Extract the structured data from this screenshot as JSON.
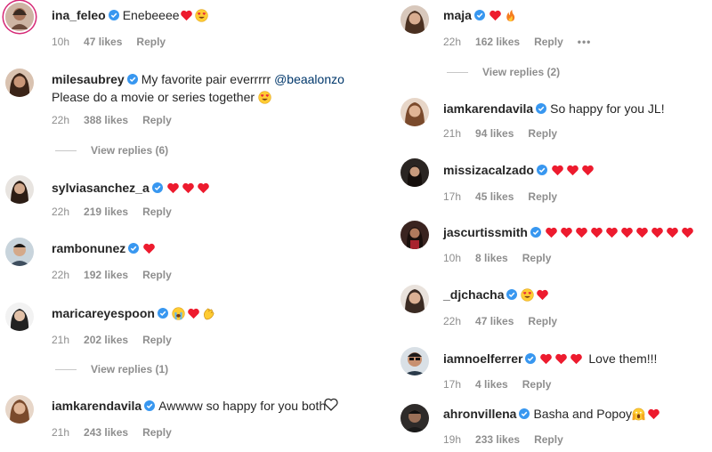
{
  "colors": {
    "verified": "#3897f0",
    "heart": "#ed1b2e",
    "mention": "#00376b",
    "meta": "#8e8e8e"
  },
  "left": [
    {
      "username": "ina_feleo",
      "text": "Enebeeee",
      "emojis": [
        "red-heart",
        "heart-eyes-face"
      ],
      "time": "10h",
      "likes": "47 likes",
      "reply": "Reply",
      "story_ring": true
    },
    {
      "username": "milesaubrey",
      "text": "My favorite pair everrrrr",
      "mention": "@beaalonzo",
      "text2": "Please do a movie or series together",
      "emojis": [
        "heart-eyes-face"
      ],
      "time": "22h",
      "likes": "388 likes",
      "reply": "Reply",
      "view_replies": "View replies (6)"
    },
    {
      "username": "sylviasanchez_a",
      "text": "",
      "emojis": [
        "red-heart",
        "red-heart",
        "red-heart"
      ],
      "time": "22h",
      "likes": "219 likes",
      "reply": "Reply"
    },
    {
      "username": "rambonunez",
      "text": "",
      "emojis": [
        "red-heart"
      ],
      "time": "22h",
      "likes": "192 likes",
      "reply": "Reply"
    },
    {
      "username": "maricareyespoon",
      "text": "",
      "emojis": [
        "crying-face",
        "red-heart",
        "clapping-hands"
      ],
      "time": "21h",
      "likes": "202 likes",
      "reply": "Reply",
      "view_replies": "View replies (1)"
    },
    {
      "username": "iamkarendavila",
      "text": "Awwww so happy for you both",
      "emojis": [],
      "time": "21h",
      "likes": "243 likes",
      "reply": "Reply",
      "like_icon": "heart-outline-icon"
    }
  ],
  "right": [
    {
      "username": "maja",
      "text": "",
      "emojis": [
        "red-heart",
        "fire"
      ],
      "time": "22h",
      "likes": "162 likes",
      "reply": "Reply",
      "more": "•••",
      "view_replies": "View replies (2)"
    },
    {
      "username": "iamkarendavila",
      "text": "So happy for you JL!",
      "emojis": [],
      "time": "21h",
      "likes": "94 likes",
      "reply": "Reply"
    },
    {
      "username": "missizacalzado",
      "text": "",
      "emojis": [
        "red-heart",
        "red-heart",
        "red-heart"
      ],
      "time": "17h",
      "likes": "45 likes",
      "reply": "Reply"
    },
    {
      "username": "jascurtissmith",
      "text": "",
      "emojis": [
        "red-heart",
        "red-heart",
        "red-heart",
        "red-heart",
        "red-heart",
        "red-heart",
        "red-heart",
        "red-heart",
        "red-heart",
        "red-heart"
      ],
      "time": "10h",
      "likes": "8 likes",
      "reply": "Reply"
    },
    {
      "username": "_djchacha",
      "text": "",
      "emojis": [
        "heart-eyes-face",
        "red-heart"
      ],
      "time": "22h",
      "likes": "47 likes",
      "reply": "Reply"
    },
    {
      "username": "iamnoelferrer",
      "text": "Love them!!!",
      "emojis_before": [
        "red-heart",
        "red-heart",
        "red-heart"
      ],
      "emojis": [],
      "time": "17h",
      "likes": "4 likes",
      "reply": "Reply"
    },
    {
      "username": "ahronvillena",
      "text": "Basha and Popoy",
      "emojis": [
        "screaming-face",
        "red-heart"
      ],
      "time": "19h",
      "likes": "233 likes",
      "reply": "Reply"
    }
  ]
}
